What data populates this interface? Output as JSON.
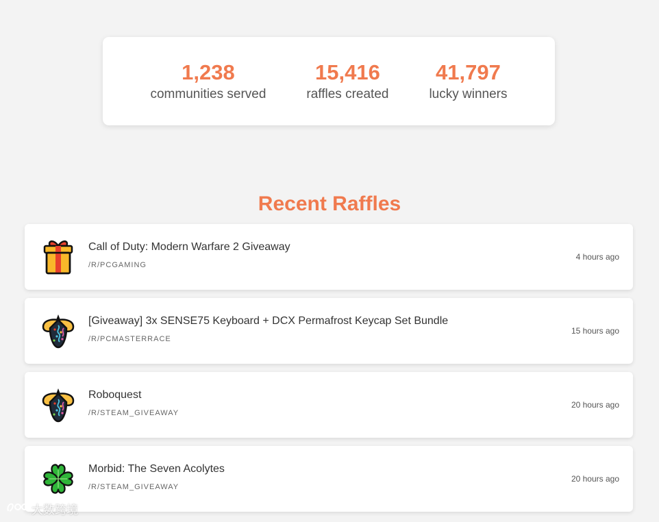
{
  "stats": [
    {
      "number": "1,238",
      "label": "communities served"
    },
    {
      "number": "15,416",
      "label": "raffles created"
    },
    {
      "number": "41,797",
      "label": "lucky winners"
    }
  ],
  "section_title": "Recent Raffles",
  "raffles": [
    {
      "title": "Call of Duty: Modern Warfare 2 Giveaway",
      "subreddit": "/R/PCGAMING",
      "time": "4 hours ago",
      "icon": "gift-icon"
    },
    {
      "title": "[Giveaway] 3x SENSE75 Keyboard + DCX Permafrost Keycap Set Bundle",
      "subreddit": "/R/PCMASTERRACE",
      "time": "15 hours ago",
      "icon": "party-popper-icon"
    },
    {
      "title": "Roboquest",
      "subreddit": "/R/STEAM_GIVEAWAY",
      "time": "20 hours ago",
      "icon": "party-popper-icon"
    },
    {
      "title": "Morbid: The Seven Acolytes",
      "subreddit": "/R/STEAM_GIVEAWAY",
      "time": "20 hours ago",
      "icon": "four-leaf-clover-icon"
    }
  ],
  "watermark": "大数跨境",
  "colors": {
    "accent": "#f07a4e",
    "background": "#f3f3f3",
    "card": "#ffffff"
  }
}
